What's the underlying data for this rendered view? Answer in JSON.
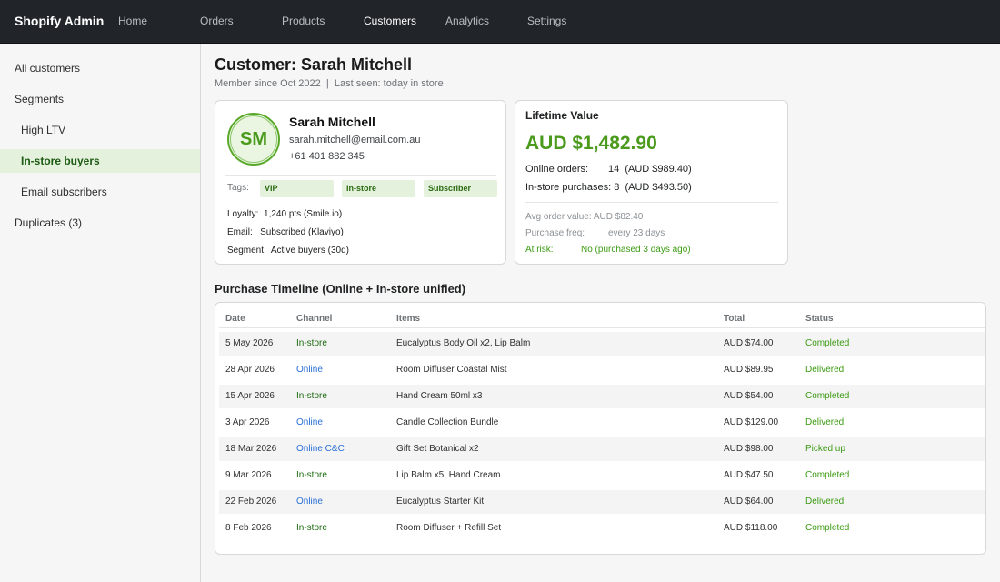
{
  "app": {
    "brand": "Shopify Admin"
  },
  "nav": [
    {
      "label": "Home",
      "active": false
    },
    {
      "label": "Orders",
      "active": false
    },
    {
      "label": "Products",
      "active": false
    },
    {
      "label": "Customers",
      "active": true
    },
    {
      "label": "Analytics",
      "active": false
    },
    {
      "label": "Settings",
      "active": false
    }
  ],
  "sidebar": {
    "items": [
      {
        "label": "All customers"
      },
      {
        "label": "Segments"
      },
      {
        "label": "High LTV"
      },
      {
        "label": "In-store buyers",
        "active": true
      },
      {
        "label": "Email subscribers"
      },
      {
        "label": "Duplicates (3)"
      }
    ]
  },
  "page": {
    "title": "Customer: Sarah Mitchell",
    "subtitle": "Member since Oct 2022  |  Last seen: today in store"
  },
  "customer": {
    "initials": "SM",
    "name": "Sarah Mitchell",
    "email": "sarah.mitchell@email.com.au",
    "phone": "+61 401 882 345",
    "tags_label": "Tags:",
    "tags": [
      "VIP",
      "In-store",
      "Subscriber"
    ],
    "loyalty_label": "Loyalty:",
    "loyalty_value": "1,240 pts (Smile.io)",
    "email_label": "Email:",
    "email_value": "Subscribed (Klaviyo)",
    "segment_label": "Segment:",
    "segment_value": "Active buyers (30d)"
  },
  "ltv": {
    "title": "Lifetime Value",
    "value": "AUD $1,482.90",
    "online_label": "Online orders:",
    "online_value": "14  (AUD $989.40)",
    "instore_label": "In-store purchases:",
    "instore_value": "8  (AUD $493.50)",
    "aov_label": "Avg order value:",
    "aov_value": "AUD $82.40",
    "freq_label": "Purchase freq:",
    "freq_value": "every 23 days",
    "risk_label": "At risk:",
    "risk_value": "No (purchased 3 days ago)"
  },
  "timeline": {
    "title": "Purchase Timeline (Online + In-store unified)",
    "headers": [
      "Date",
      "Channel",
      "Items",
      "Total",
      "Status"
    ],
    "rows": [
      {
        "date": "5 May 2026",
        "channel": "In-store",
        "items": "Eucalyptus Body Oil x2, Lip Balm",
        "total": "AUD $74.00",
        "status": "Completed"
      },
      {
        "date": "28 Apr 2026",
        "channel": "Online",
        "items": "Room Diffuser Coastal Mist",
        "total": "AUD $89.95",
        "status": "Delivered"
      },
      {
        "date": "15 Apr 2026",
        "channel": "In-store",
        "items": "Hand Cream 50ml x3",
        "total": "AUD $54.00",
        "status": "Completed"
      },
      {
        "date": "3 Apr 2026",
        "channel": "Online",
        "items": "Candle Collection Bundle",
        "total": "AUD $129.00",
        "status": "Delivered"
      },
      {
        "date": "18 Mar 2026",
        "channel": "Online C&C",
        "items": "Gift Set Botanical x2",
        "total": "AUD $98.00",
        "status": "Picked up"
      },
      {
        "date": "9 Mar 2026",
        "channel": "In-store",
        "items": "Lip Balm x5, Hand Cream",
        "total": "AUD $47.50",
        "status": "Completed"
      },
      {
        "date": "22 Feb 2026",
        "channel": "Online",
        "items": "Eucalyptus Starter Kit",
        "total": "AUD $64.00",
        "status": "Delivered"
      },
      {
        "date": "8 Feb 2026",
        "channel": "In-store",
        "items": "Room Diffuser + Refill Set",
        "total": "AUD $118.00",
        "status": "Completed"
      }
    ]
  }
}
